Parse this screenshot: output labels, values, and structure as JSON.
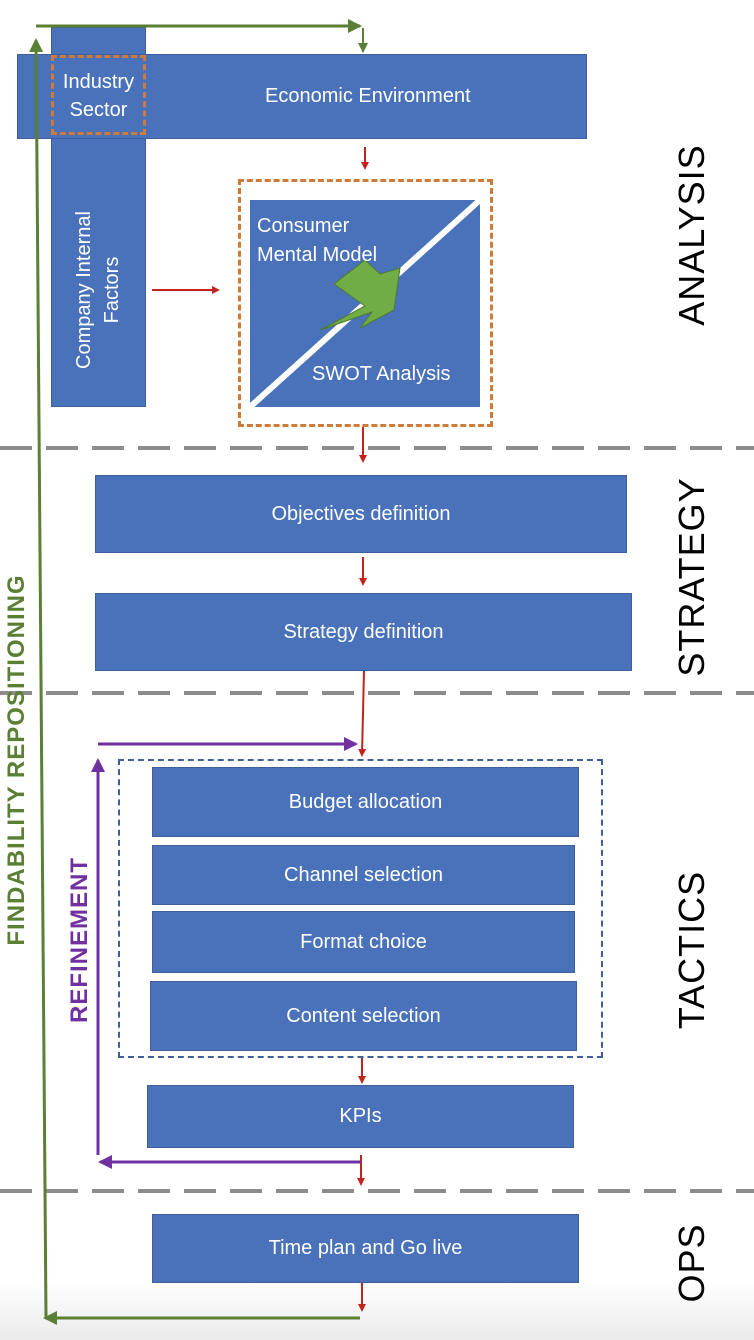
{
  "phases": {
    "analysis": "ANALYSIS",
    "strategy": "STRATEGY",
    "tactics": "TACTICS",
    "ops": "OPS"
  },
  "analysis": {
    "economic_environment": "Economic Environment",
    "industry_sector_line1": "Industry",
    "industry_sector_line2": "Sector",
    "company_internal_line1": "Company Internal",
    "company_internal_line2": "Factors",
    "consumer_mental_model_line1": "Consumer",
    "consumer_mental_model_line2": "Mental Model",
    "swot_analysis": "SWOT Analysis"
  },
  "strategy": {
    "objectives": "Objectives definition",
    "strategy_def": "Strategy definition"
  },
  "tactics": {
    "budget": "Budget allocation",
    "channel": "Channel selection",
    "format": "Format choice",
    "content": "Content selection",
    "kpis": "KPIs"
  },
  "ops": {
    "time_plan": "Time plan and Go live"
  },
  "loops": {
    "findability": "FINDABILITY REPOSITIONING",
    "refinement": "REFINEMENT"
  },
  "colors": {
    "box_blue": "#4a72bb",
    "flow_red": "#c0241c",
    "loop_green": "#5b7f35",
    "refinement_purple": "#7030a0",
    "dashed_orange": "#d07a3a",
    "dashed_navy": "#3f5f9c",
    "separator_gray": "#8c8c8c"
  }
}
